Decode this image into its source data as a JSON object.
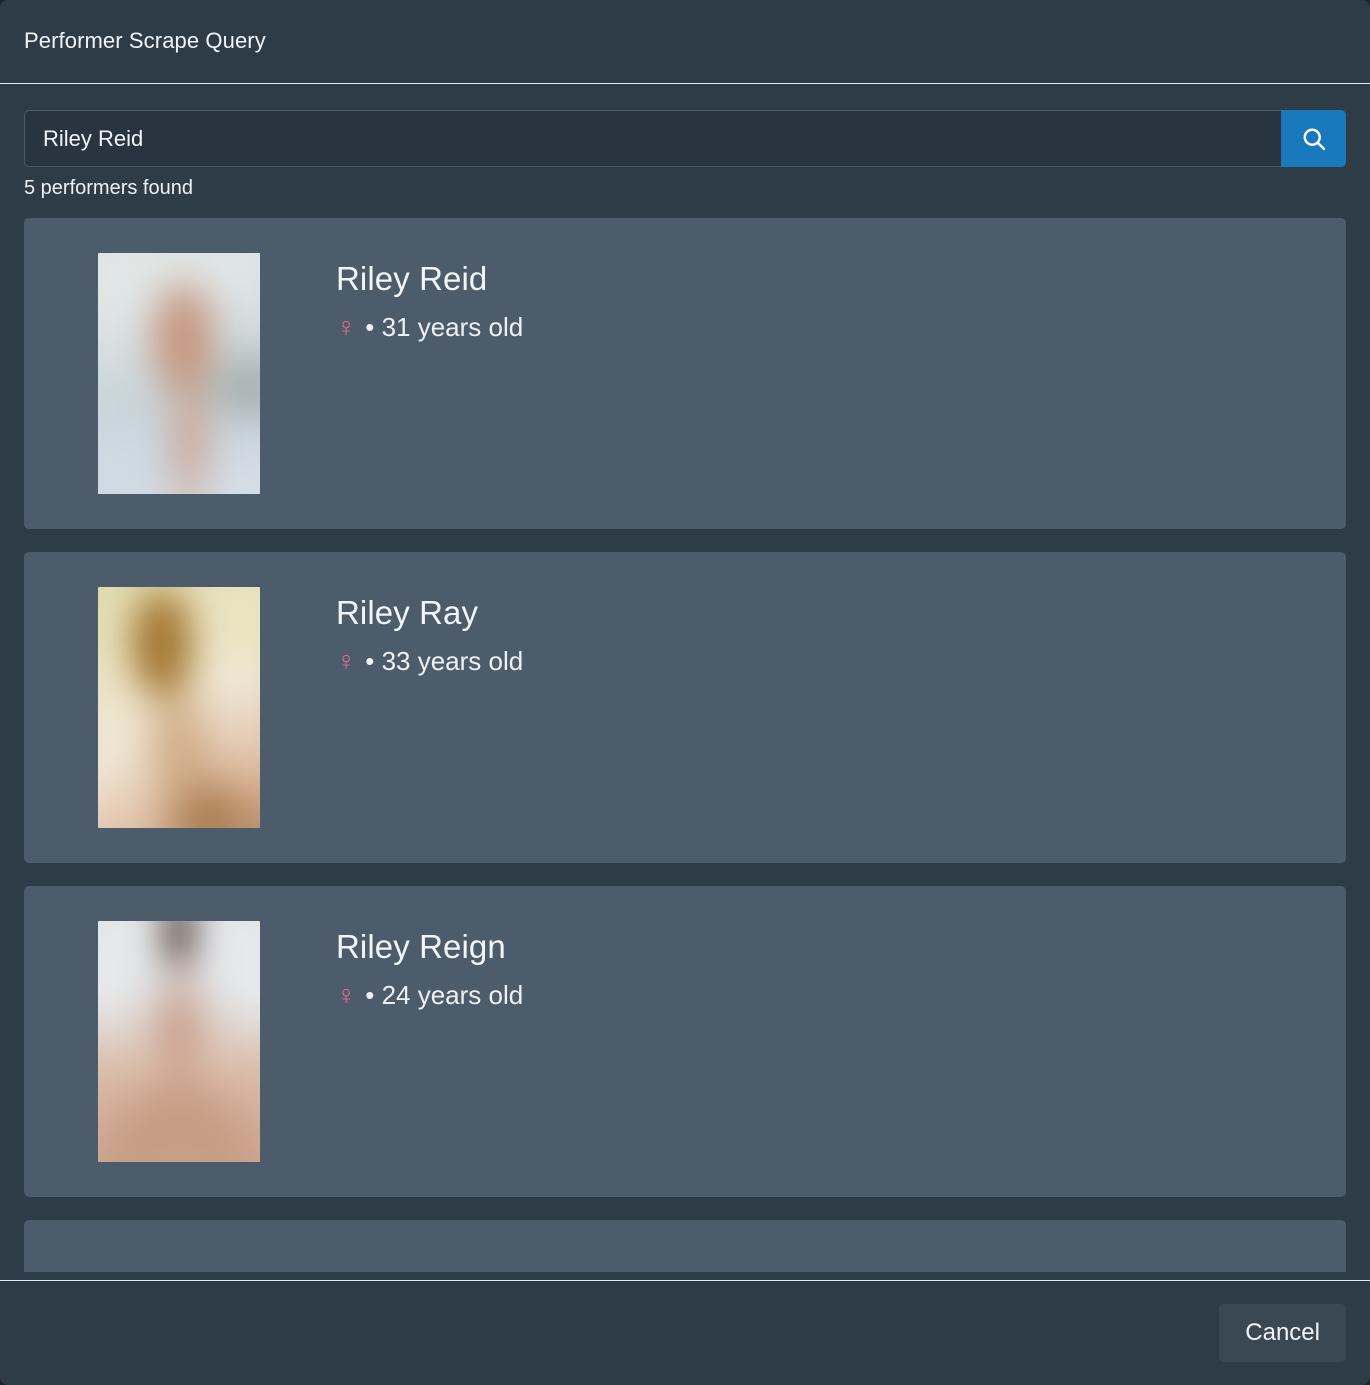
{
  "header": {
    "title": "Performer Scrape Query"
  },
  "search": {
    "value": "Riley Reid",
    "placeholder": "",
    "button_icon": "search-icon"
  },
  "results": {
    "count_label": "5 performers found",
    "performers": [
      {
        "name": "Riley Reid",
        "gender_icon": "female-icon",
        "gender_symbol": "♀",
        "meta": "• 31 years old",
        "age": 31
      },
      {
        "name": "Riley Ray",
        "gender_icon": "female-icon",
        "gender_symbol": "♀",
        "meta": "• 33 years old",
        "age": 33
      },
      {
        "name": "Riley Reign",
        "gender_icon": "female-icon",
        "gender_symbol": "♀",
        "meta": "• 24 years old",
        "age": 24
      }
    ]
  },
  "footer": {
    "cancel_label": "Cancel"
  },
  "colors": {
    "modal_background": "#2e3c48",
    "card_background": "#4d5c6b",
    "input_background": "#283541",
    "accent_blue": "#1a78bd",
    "gender_pink": "#e8678f",
    "text_primary": "#f2f5f7",
    "divider": "#e9ecef",
    "cancel_background": "#3a4854"
  }
}
